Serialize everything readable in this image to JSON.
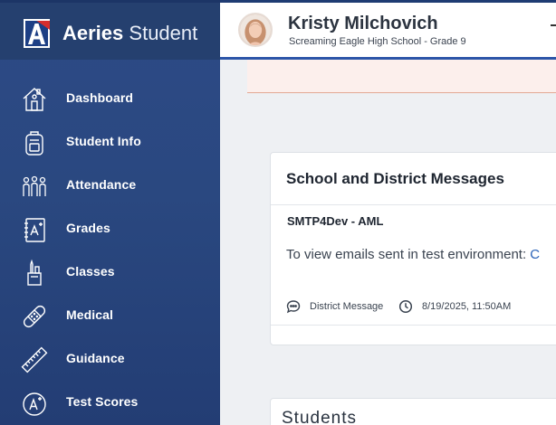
{
  "brand": {
    "name_bold": "Aeries",
    "name_light": "Student"
  },
  "sidebar": {
    "items": [
      {
        "label": "Dashboard",
        "icon": "house-icon"
      },
      {
        "label": "Student Info",
        "icon": "backpack-icon"
      },
      {
        "label": "Attendance",
        "icon": "people-group-icon"
      },
      {
        "label": "Grades",
        "icon": "grade-book-icon"
      },
      {
        "label": "Classes",
        "icon": "pencil-cup-icon"
      },
      {
        "label": "Medical",
        "icon": "bandage-icon"
      },
      {
        "label": "Guidance",
        "icon": "ruler-icon"
      },
      {
        "label": "Test Scores",
        "icon": "a-plus-badge-icon"
      }
    ]
  },
  "header": {
    "student_name": "Kristy Milchovich",
    "student_sub": "Screaming Eagle High School - Grade 9"
  },
  "messages_card": {
    "title": "School and District Messages",
    "subject": "SMTP4Dev - AML",
    "body_prefix": "To view emails sent in test environment: ",
    "body_link": "C",
    "message_type": "District Message",
    "timestamp": "8/19/2025, 11:50AM"
  },
  "students_card": {
    "title": "Students"
  },
  "colors": {
    "sidebar": "#2a4880",
    "header_accent": "#2c55a8",
    "alert_bg": "#fcefec",
    "link": "#2b63b8"
  }
}
